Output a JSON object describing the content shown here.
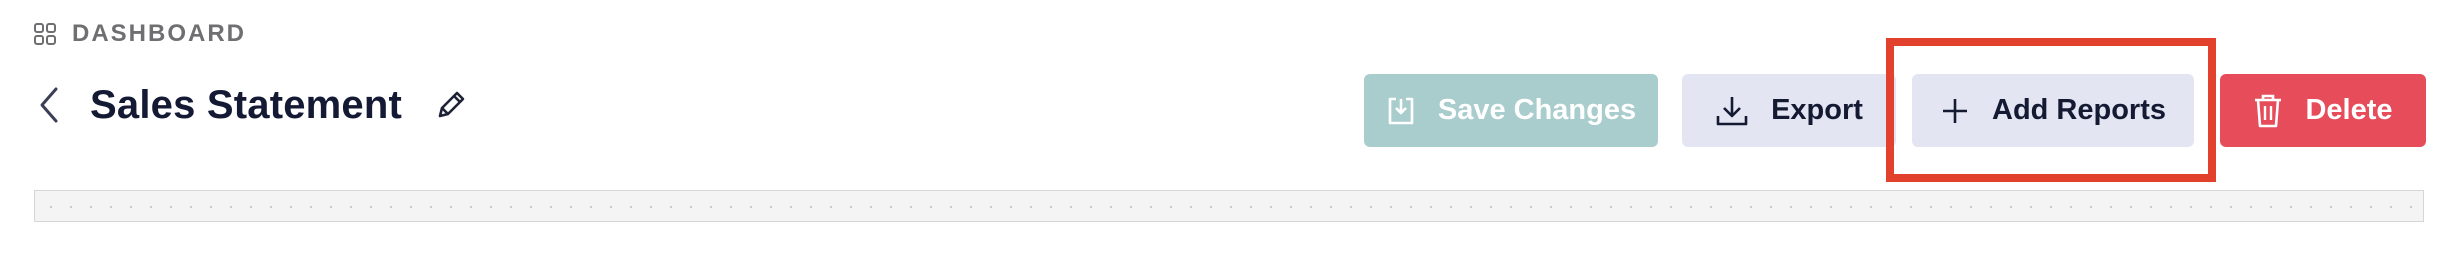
{
  "breadcrumb": {
    "icon": "grid-icon",
    "label": "DASHBOARD"
  },
  "header": {
    "back_icon": "chevron-left-icon",
    "title": "Sales Statement",
    "edit_icon": "pencil-icon"
  },
  "toolbar": {
    "save_label": "Save Changes",
    "save_icon": "save-icon",
    "export_label": "Export",
    "export_icon": "download-icon",
    "add_label": "Add Reports",
    "add_icon": "plus-icon",
    "delete_label": "Delete",
    "delete_icon": "trash-icon"
  },
  "colors": {
    "save_bg": "#a9cccd",
    "secondary_bg": "#e3e5f3",
    "delete_bg": "#e74c5b",
    "highlight": "#e2412d",
    "title_text": "#141a33"
  }
}
